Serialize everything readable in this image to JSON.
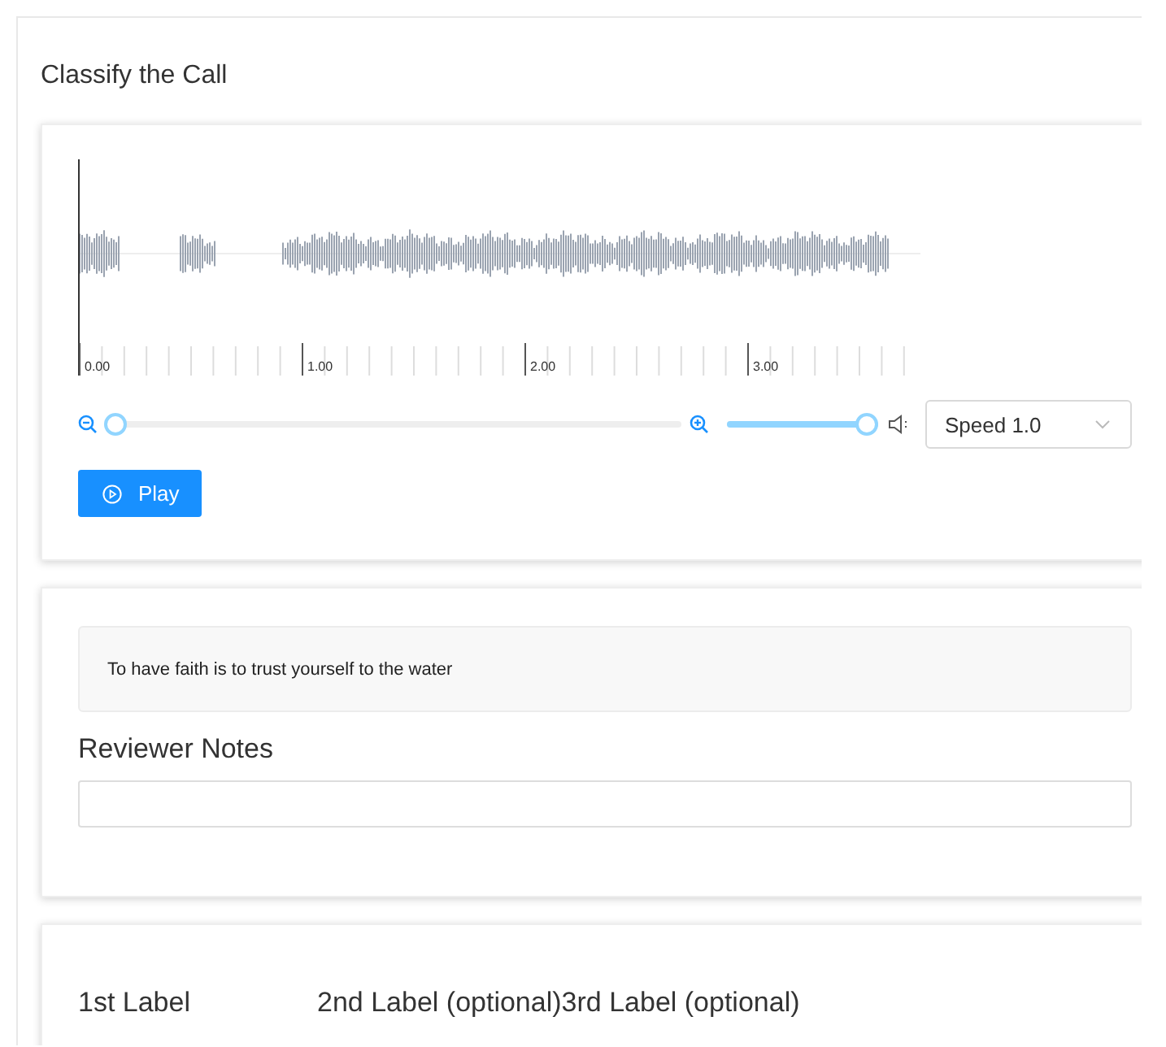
{
  "title": "Classify the Call",
  "player": {
    "timeline": [
      "0.00",
      "1.00",
      "2.00",
      "3.00"
    ],
    "zoom": {
      "level": 0
    },
    "volume": {
      "level": 1
    },
    "speed": {
      "value": "Speed 1.0"
    },
    "play_button": "Play"
  },
  "transcript": "To have faith is to trust yourself to the water",
  "notes": {
    "label": "Reviewer Notes"
  },
  "labels": [
    "1st Label",
    "2nd Label (optional)",
    "3rd Label (optional)"
  ]
}
